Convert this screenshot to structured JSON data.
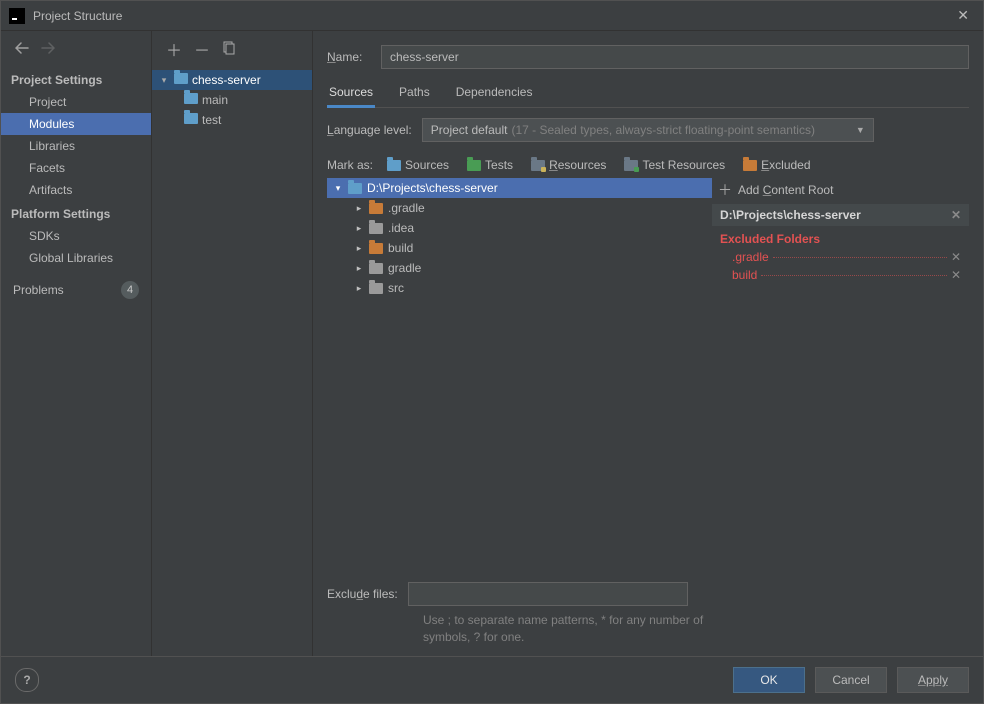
{
  "window": {
    "title": "Project Structure"
  },
  "sidebar": {
    "sections": [
      {
        "label": "Project Settings",
        "items": [
          {
            "id": "project",
            "label": "Project"
          },
          {
            "id": "modules",
            "label": "Modules",
            "selected": true
          },
          {
            "id": "libraries",
            "label": "Libraries"
          },
          {
            "id": "facets",
            "label": "Facets"
          },
          {
            "id": "artifacts",
            "label": "Artifacts"
          }
        ]
      },
      {
        "label": "Platform Settings",
        "items": [
          {
            "id": "sdks",
            "label": "SDKs"
          },
          {
            "id": "global-libraries",
            "label": "Global Libraries"
          }
        ]
      }
    ],
    "problems": {
      "label": "Problems",
      "count": "4"
    }
  },
  "module_tree": {
    "root": {
      "label": "chess-server",
      "expanded": true
    },
    "children": [
      {
        "id": "main",
        "label": "main"
      },
      {
        "id": "test",
        "label": "test"
      }
    ]
  },
  "editor": {
    "name_label": "Name:",
    "name_value": "chess-server",
    "tabs": [
      {
        "id": "sources",
        "label": "Sources",
        "active": true
      },
      {
        "id": "paths",
        "label": "Paths"
      },
      {
        "id": "dependencies",
        "label": "Dependencies"
      }
    ],
    "language_level": {
      "label": "Language level:",
      "value": "Project default",
      "hint": "(17 - Sealed types, always-strict floating-point semantics)"
    },
    "mark_as": {
      "label": "Mark as:",
      "options": [
        {
          "id": "sources",
          "label": "Sources",
          "color": "#5f9ec9"
        },
        {
          "id": "tests",
          "label": "Tests",
          "color": "#499c54"
        },
        {
          "id": "resources",
          "label": "Resources",
          "color": "#5f6e7a"
        },
        {
          "id": "test-resources",
          "label": "Test Resources",
          "color": "#5f6e7a"
        },
        {
          "id": "excluded",
          "label": "Excluded",
          "color": "#c77b38"
        }
      ]
    },
    "content_tree": {
      "root": {
        "label": "D:\\Projects\\chess-server",
        "color": "#5f9ec9",
        "selected": true
      },
      "children": [
        {
          "id": "dot-gradle",
          "label": ".gradle",
          "color": "#c77b38"
        },
        {
          "id": "dot-idea",
          "label": ".idea",
          "color": "#9a9a9a"
        },
        {
          "id": "build",
          "label": "build",
          "color": "#c77b38"
        },
        {
          "id": "gradle",
          "label": "gradle",
          "color": "#9a9a9a"
        },
        {
          "id": "src",
          "label": "src",
          "color": "#9a9a9a"
        }
      ]
    },
    "exclude": {
      "label": "Exclude files:",
      "value": "",
      "hint": "Use ; to separate name patterns, * for any number of symbols, ? for one."
    },
    "roots": {
      "add_label": "Add Content Root",
      "root_path": "D:\\Projects\\chess-server",
      "excluded_label": "Excluded Folders",
      "excluded_folders": [
        {
          "id": "dot-gradle",
          "label": ".gradle"
        },
        {
          "id": "build",
          "label": "build"
        }
      ]
    }
  },
  "footer": {
    "ok": "OK",
    "cancel": "Cancel",
    "apply": "Apply"
  }
}
